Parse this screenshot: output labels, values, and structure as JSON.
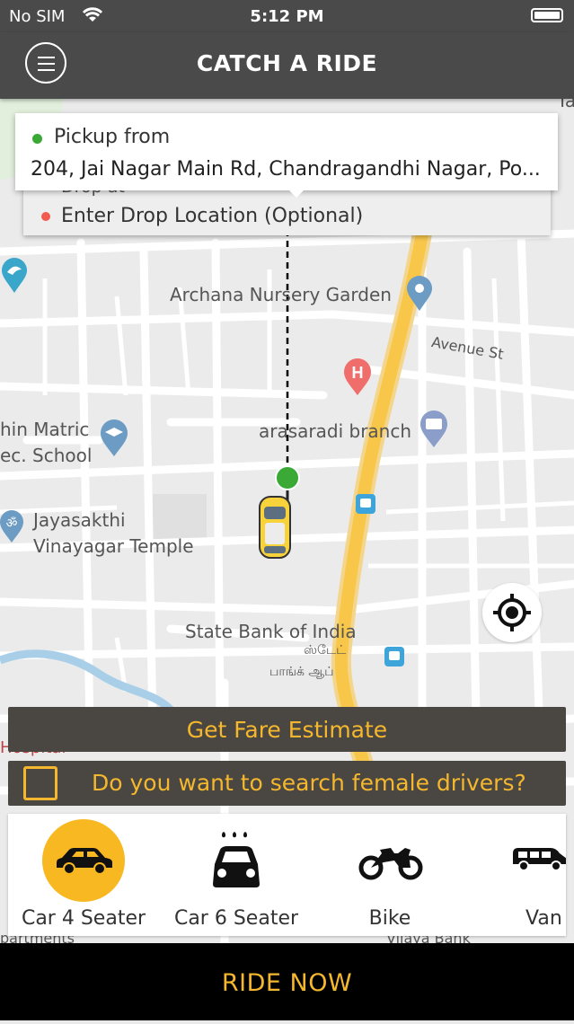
{
  "status_bar": {
    "carrier": "No SIM",
    "time": "5:12 PM"
  },
  "header": {
    "title": "CATCH A RIDE"
  },
  "pickup": {
    "label": "Pickup from",
    "address": "204, Jai Nagar Main Rd, Chandragandhi Nagar, Po..."
  },
  "drop": {
    "small_label": "Drop at",
    "label": "Enter Drop Location (Optional)"
  },
  "map": {
    "labels": {
      "nursery": "Archana Nursery Garden",
      "avenue": "Avenue St",
      "branch": "arasaradi branch",
      "school_1": "hin Matric",
      "school_2": "ec. School",
      "temple_1": "Jayasakthi",
      "temple_2": "Vinayagar Temple",
      "bank": "State Bank of India",
      "bank_tamil_1": "ஸ்டேட்",
      "bank_tamil_2": "பாங்க் ஆப்",
      "tamilnad": "Tamilnad",
      "hospital": "Hospital",
      "apartments": "partments",
      "vijaya": "Vijaya Bank"
    }
  },
  "actions": {
    "fare_estimate": "Get Fare Estimate",
    "female_drivers": "Do you want to search female drivers?",
    "ride_now": "RIDE NOW"
  },
  "vehicles": [
    {
      "label": "Car 4 Seater",
      "icon": "car-icon",
      "selected": true
    },
    {
      "label": "Car 6 Seater",
      "icon": "taxi-icon",
      "selected": false
    },
    {
      "label": "Bike",
      "icon": "motorbike-icon",
      "selected": false
    },
    {
      "label": "Van",
      "icon": "van-icon",
      "selected": false
    }
  ],
  "colors": {
    "accent": "#f5b72d",
    "header": "#4a4a4a",
    "pickup_dot": "#3aa935",
    "drop_dot": "#f05a4f"
  }
}
